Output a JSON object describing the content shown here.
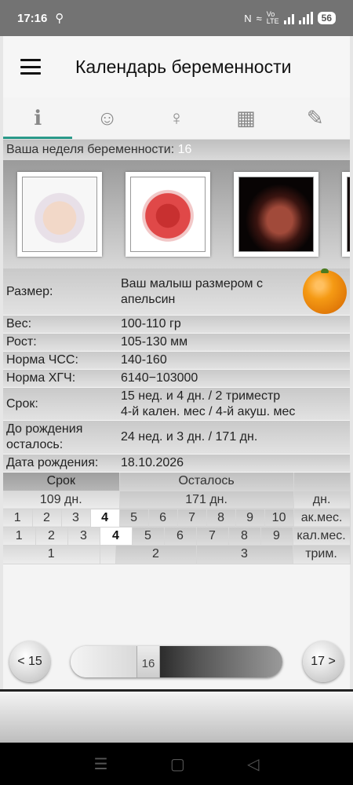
{
  "status": {
    "time": "17:16",
    "battery": "56"
  },
  "app": {
    "title": "Календарь беременности"
  },
  "tabs": [
    {
      "icon": "info-person-icon",
      "glyph": "ℹ"
    },
    {
      "icon": "baby-icon",
      "glyph": "☺"
    },
    {
      "icon": "pregnant-woman-icon",
      "glyph": "♀"
    },
    {
      "icon": "calendar-icon",
      "glyph": "▦"
    },
    {
      "icon": "notes-icon",
      "glyph": "✎"
    }
  ],
  "week": {
    "label": "Ваша неделя беременности:",
    "value": "16"
  },
  "info": {
    "size_label": "Размер:",
    "size_value": "Ваш малыш размером с апельсин",
    "weight_label": "Вес:",
    "weight_value": "100-110 гр",
    "height_label": "Рост:",
    "height_value": "105-130 мм",
    "hr_label": "Норма ЧСС:",
    "hr_value": "140-160",
    "hcg_label": "Норма ХГЧ:",
    "hcg_value": "6140−103000",
    "term_label": "Срок:",
    "term_value_1": "15 нед. и 4 дн. / 2 триместр",
    "term_value_2": "4-й кален. мес / 4-й акуш. мес",
    "remain_label_1": "До рождения",
    "remain_label_2": "осталось:",
    "remain_value": "24 нед. и 3 дн. / 171 дн.",
    "birth_label": "Дата рождения:",
    "birth_value": "18.10.2026"
  },
  "grid": {
    "h_term": "Срок",
    "h_remain": "Осталось",
    "days_passed": "109 дн.",
    "days_left": "171 дн.",
    "u_days": "дн.",
    "ak_months": [
      "1",
      "2",
      "3",
      "4",
      "5",
      "6",
      "7",
      "8",
      "9",
      "10"
    ],
    "u_ak": "ак.мес.",
    "cal_months": [
      "1",
      "2",
      "3",
      "4",
      "5",
      "6",
      "7",
      "8",
      "9"
    ],
    "u_cal": "кал.мес.",
    "trimesters": [
      "1",
      "2",
      "3"
    ],
    "u_trim": "трим."
  },
  "nav": {
    "prev": "< 15",
    "current": "16",
    "next": "17 >",
    "progress_weeks": 16
  }
}
